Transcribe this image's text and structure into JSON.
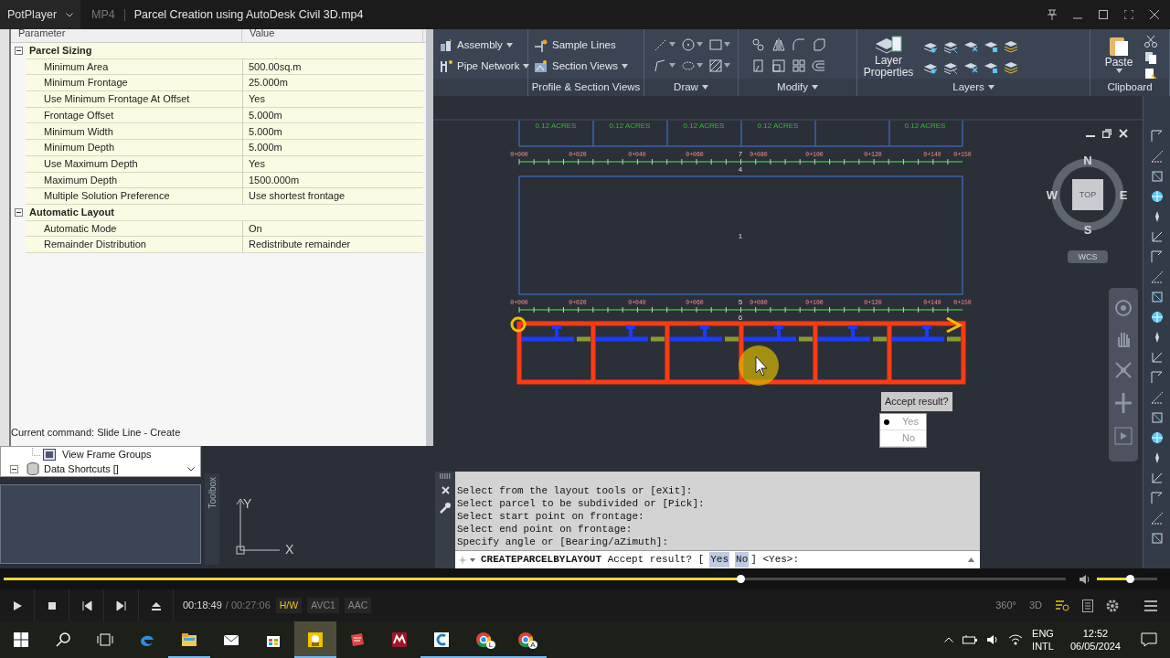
{
  "player": {
    "app": "PotPlayer",
    "format": "MP4",
    "title": "Parcel Creation using AutoDesk Civil 3D.mp4"
  },
  "properties": {
    "columns": [
      "Parameter",
      "Value"
    ],
    "groups": [
      {
        "name": "Parcel Sizing",
        "expanded": true,
        "rows": [
          {
            "name": "Minimum Area",
            "value": "500.00sq.m"
          },
          {
            "name": "Minimum Frontage",
            "value": "25.000m"
          },
          {
            "name": "Use Minimum Frontage At Offset",
            "value": "Yes"
          },
          {
            "name": "Frontage Offset",
            "value": "5.000m"
          },
          {
            "name": "Minimum Width",
            "value": "5.000m"
          },
          {
            "name": "Minimum Depth",
            "value": "5.000m"
          },
          {
            "name": "Use Maximum Depth",
            "value": "Yes"
          },
          {
            "name": "Maximum Depth",
            "value": "1500.000m"
          },
          {
            "name": "Multiple Solution Preference",
            "value": "Use shortest frontage"
          }
        ]
      },
      {
        "name": "Automatic Layout",
        "expanded": true,
        "rows": [
          {
            "name": "Automatic Mode",
            "value": "On"
          },
          {
            "name": "Remainder Distribution",
            "value": "Redistribute remainder"
          }
        ]
      }
    ],
    "status": "Current command: Slide Line - Create"
  },
  "prospector": {
    "items": [
      {
        "label": "View Frame Groups",
        "kind": "child"
      },
      {
        "label": "Data Shortcuts []",
        "kind": "root",
        "expanded": true
      }
    ]
  },
  "toolbox_label": "Toolbox",
  "ucs_axes": {
    "x": "X",
    "y": "Y"
  },
  "ribbon": {
    "panels": [
      {
        "kind": "list",
        "items": [
          {
            "label": "Assembly",
            "menu": true
          },
          {
            "label": "Pipe Network",
            "menu": true
          }
        ]
      },
      {
        "kind": "list",
        "label": "Profile & Section Views",
        "menu": false,
        "items": [
          {
            "label": "Sample Lines",
            "menu": false
          },
          {
            "label": "Section Views",
            "menu": true
          }
        ]
      },
      {
        "kind": "draw",
        "label": "Draw",
        "menu": true
      },
      {
        "kind": "modify",
        "label": "Modify",
        "menu": true
      },
      {
        "kind": "layers",
        "label": "Layers",
        "menu": true,
        "items": [
          {
            "label": "Layer Properties",
            "menu": false
          }
        ]
      },
      {
        "kind": "clipboard",
        "label": "Clipboard",
        "menu": false,
        "items": [
          {
            "label": "Paste",
            "menu": true
          }
        ]
      }
    ]
  },
  "drawing": {
    "acres_labels": [
      "0.12 ACRES",
      "0.12 ACRES",
      "0.12 ACRES",
      "0.12 ACRES",
      "0.12 ACRES"
    ],
    "stations_top": [
      "0+000",
      "0+020",
      "0+040",
      "0+060",
      "0+080",
      "0+100",
      "0+120",
      "0+140",
      "0+150"
    ],
    "stations_bottom": [
      "0+000",
      "0+020",
      "0+040",
      "0+060",
      "0+080",
      "0+100",
      "0+120",
      "0+140",
      "0+150"
    ],
    "parcel_numbers": [
      "7",
      "4",
      "1",
      "5",
      "6"
    ]
  },
  "viewcube": {
    "face": "TOP",
    "north": "N",
    "south": "S",
    "east": "E",
    "west": "W",
    "ucs": "WCS"
  },
  "accept_menu": {
    "title": "Accept result?",
    "options": [
      {
        "label": "Yes",
        "selected": true
      },
      {
        "label": "No",
        "selected": false
      }
    ]
  },
  "command_line": {
    "history": [
      "Select from the layout tools or [eXit]:",
      "Select parcel to be subdivided or [Pick]:",
      "Select start point on frontage:",
      "Select end point on frontage:",
      "Specify angle or [Bearing/aZimuth]:"
    ],
    "command": "CREATEPARCELBYLAYOUT",
    "prompt": "Accept result? [",
    "options": [
      "Yes",
      "No"
    ],
    "suffix": "] <Yes>:"
  },
  "playback": {
    "level": 0.694,
    "position": "00:18:49",
    "duration": "/ 00:27:06",
    "tags": [
      {
        "label": "H/W",
        "active": true
      },
      {
        "label": "AVC1",
        "active": false
      },
      {
        "label": "AAC",
        "active": false
      }
    ],
    "volume": {
      "level": 0.55
    },
    "view_labels": [
      "360°",
      "3D"
    ]
  },
  "taskbar": {
    "apps": [
      {
        "kind": "edge",
        "running": false,
        "selected": false
      },
      {
        "kind": "folder",
        "running": true,
        "selected": false
      },
      {
        "kind": "mail",
        "running": false,
        "selected": false
      },
      {
        "kind": "store",
        "running": false,
        "selected": false
      },
      {
        "kind": "viewer",
        "running": true,
        "selected": true
      },
      {
        "kind": "slides",
        "running": false,
        "selected": false
      },
      {
        "kind": "mendeley",
        "running": false,
        "selected": false
      },
      {
        "kind": "cad",
        "running": true,
        "selected": false
      },
      {
        "kind": "chrome",
        "badge": "L",
        "running": true,
        "selected": false
      },
      {
        "kind": "chrome",
        "badge": "A",
        "running": true,
        "selected": false
      }
    ],
    "language": [
      "ENG",
      "INTL"
    ],
    "time": "12:52",
    "date": "06/05/2024"
  }
}
